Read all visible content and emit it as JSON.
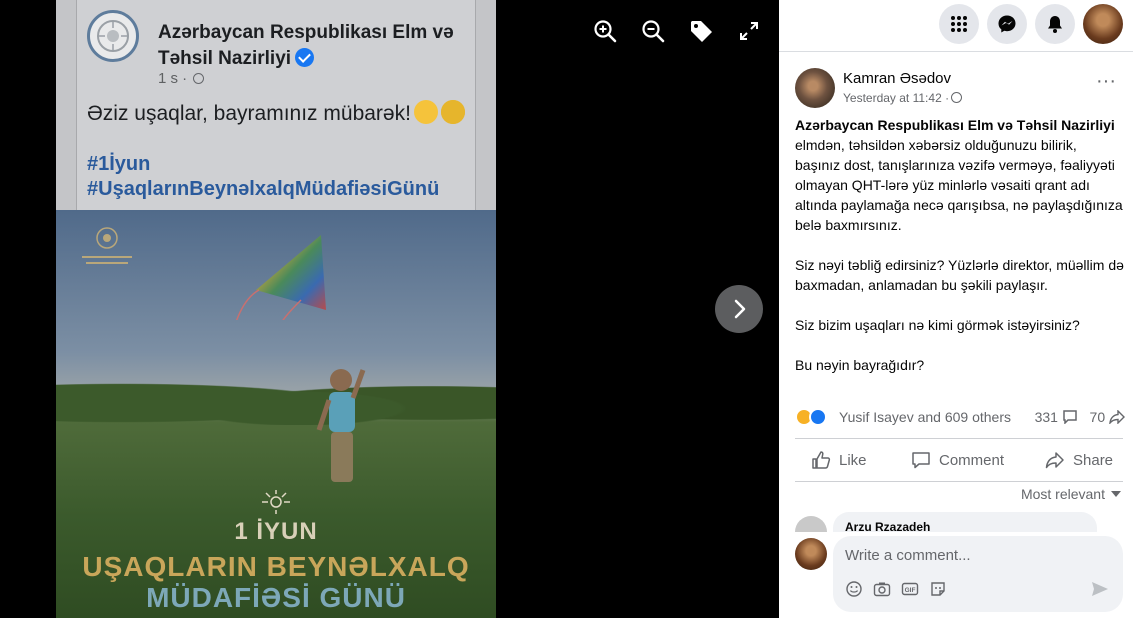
{
  "viewer": {
    "post_card": {
      "org_name": "Azərbaycan Respublikası Elm və Təhsil Nazirliyi",
      "meta": "1 s ·",
      "text": "Əziz uşaqlar, bayramınız mübarək!",
      "hashtag1": "#1İyun",
      "hashtag2": "#UşaqlarınBeynəlxalqMüdafiəsiGünü"
    },
    "image_text": {
      "line1": "1 İYUN",
      "line2": "UŞAQLARIN BEYNƏLXALQ",
      "line3": "MÜDAFİƏSİ GÜNÜ"
    },
    "toolbar": {
      "zoom_in": "zoom-in-icon",
      "zoom_out": "zoom-out-icon",
      "tag": "tag-icon",
      "fullscreen": "fullscreen-icon"
    },
    "next": "chevron-right-icon"
  },
  "topbar": {
    "menu": "grid-menu-icon",
    "messenger": "messenger-icon",
    "notifications": "bell-icon"
  },
  "post": {
    "author": "Kamran Əsədov",
    "time": "Yesterday at 11:42 ·",
    "more": "···",
    "tag": "Azərbaycan Respublikası Elm və Təhsil Nazirliyi",
    "paragraph1": "elmdən, təhsildən xəbərsiz olduğunuzu bilirik, başınız dost, tanışlarınıza vəzifə verməyə, fəaliyyəti olmayan QHT-lərə yüz minlərlə vəsaiti qrant adı altında paylamağa necə qarışıbsa, nə paylaşdığınıza belə baxmırsınız.",
    "paragraph2": "Siz nəyi təbliğ edirsiniz? Yüzlərlə direktor, müəllim də baxmadan, anlamadan bu şəkili paylaşır.",
    "paragraph3": "Siz bizim uşaqları nə kimi görmək istəyirsiniz?",
    "paragraph4": "Bu nəyin bayrağıdır?",
    "reactions_text": "Yusif Isayev and 609 others",
    "comments_count": "331",
    "shares_count": "70",
    "colors": {
      "haha": "#f7b125",
      "like": "#1877f2"
    }
  },
  "actions": {
    "like": "Like",
    "comment": "Comment",
    "share": "Share"
  },
  "comments": {
    "sort": "Most relevant",
    "peek_name": "Arzu Rzazadeh",
    "composer_placeholder": "Write a comment..."
  }
}
